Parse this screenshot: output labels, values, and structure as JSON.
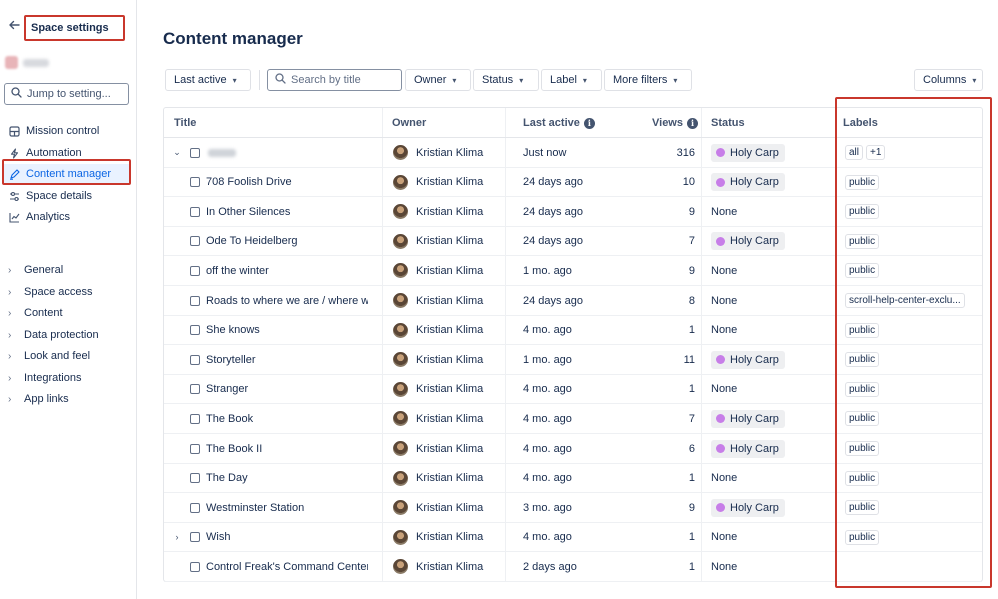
{
  "sidebar": {
    "back_icon": "arrow-left-icon",
    "title": "Space settings",
    "jump_placeholder": "Jump to setting...",
    "nav": [
      {
        "label": "Mission control",
        "icon": "monitor-icon"
      },
      {
        "label": "Automation",
        "icon": "lightning-icon"
      },
      {
        "label": "Content manager",
        "icon": "pencil-icon",
        "active": true
      },
      {
        "label": "Space details",
        "icon": "sliders-icon"
      },
      {
        "label": "Analytics",
        "icon": "chart-line-icon"
      }
    ],
    "sections": [
      "General",
      "Space access",
      "Content",
      "Data protection",
      "Look and feel",
      "Integrations",
      "App links"
    ]
  },
  "main": {
    "title": "Content manager",
    "toolbar": {
      "last_active": "Last active",
      "search_placeholder": "Search by title",
      "owner": "Owner",
      "status": "Status",
      "label": "Label",
      "more_filters": "More filters",
      "columns": "Columns"
    },
    "table": {
      "headers": {
        "title": "Title",
        "owner": "Owner",
        "last_active": "Last active",
        "views": "Views",
        "status": "Status",
        "labels": "Labels"
      },
      "rows": [
        {
          "title": "",
          "owner": "Kristian Klima",
          "last_active": "Just now",
          "views": "316",
          "status": "Holy Carp",
          "labels": [
            "all",
            "+1"
          ],
          "expand": "down"
        },
        {
          "title": "708 Foolish Drive",
          "owner": "Kristian Klima",
          "last_active": "24 days ago",
          "views": "10",
          "status": "Holy Carp",
          "labels": [
            "public"
          ]
        },
        {
          "title": "In Other Silences",
          "owner": "Kristian Klima",
          "last_active": "24 days ago",
          "views": "9",
          "status": "None",
          "labels": [
            "public"
          ]
        },
        {
          "title": "Ode To Heidelberg",
          "owner": "Kristian Klima",
          "last_active": "24 days ago",
          "views": "7",
          "status": "Holy Carp",
          "labels": [
            "public"
          ]
        },
        {
          "title": "off the winter",
          "owner": "Kristian Klima",
          "last_active": "1 mo. ago",
          "views": "9",
          "status": "None",
          "labels": [
            "public"
          ]
        },
        {
          "title": "Roads to where we are / where we'v",
          "owner": "Kristian Klima",
          "last_active": "24 days ago",
          "views": "8",
          "status": "None",
          "labels": [
            "scroll-help-center-exclu..."
          ]
        },
        {
          "title": "She knows",
          "owner": "Kristian Klima",
          "last_active": "4 mo. ago",
          "views": "1",
          "status": "None",
          "labels": [
            "public"
          ]
        },
        {
          "title": "Storyteller",
          "owner": "Kristian Klima",
          "last_active": "1 mo. ago",
          "views": "11",
          "status": "Holy Carp",
          "labels": [
            "public"
          ]
        },
        {
          "title": "Stranger",
          "owner": "Kristian Klima",
          "last_active": "4 mo. ago",
          "views": "1",
          "status": "None",
          "labels": [
            "public"
          ]
        },
        {
          "title": "The Book",
          "owner": "Kristian Klima",
          "last_active": "4 mo. ago",
          "views": "7",
          "status": "Holy Carp",
          "labels": [
            "public"
          ]
        },
        {
          "title": "The Book II",
          "owner": "Kristian Klima",
          "last_active": "4 mo. ago",
          "views": "6",
          "status": "Holy Carp",
          "labels": [
            "public"
          ]
        },
        {
          "title": "The Day",
          "owner": "Kristian Klima",
          "last_active": "4 mo. ago",
          "views": "1",
          "status": "None",
          "labels": [
            "public"
          ]
        },
        {
          "title": "Westminster Station",
          "owner": "Kristian Klima",
          "last_active": "3 mo. ago",
          "views": "9",
          "status": "Holy Carp",
          "labels": [
            "public"
          ]
        },
        {
          "title": "Wish",
          "owner": "Kristian Klima",
          "last_active": "4 mo. ago",
          "views": "1",
          "status": "None",
          "labels": [
            "public"
          ],
          "expand": "right"
        },
        {
          "title": "Control Freak's Command Center",
          "owner": "Kristian Klima",
          "last_active": "2 days ago",
          "views": "1",
          "status": "None",
          "labels": []
        }
      ]
    }
  },
  "colors": {
    "accent": "#0c66e4",
    "highlight": "#c9372c",
    "status_dot": "#c77ee8"
  }
}
